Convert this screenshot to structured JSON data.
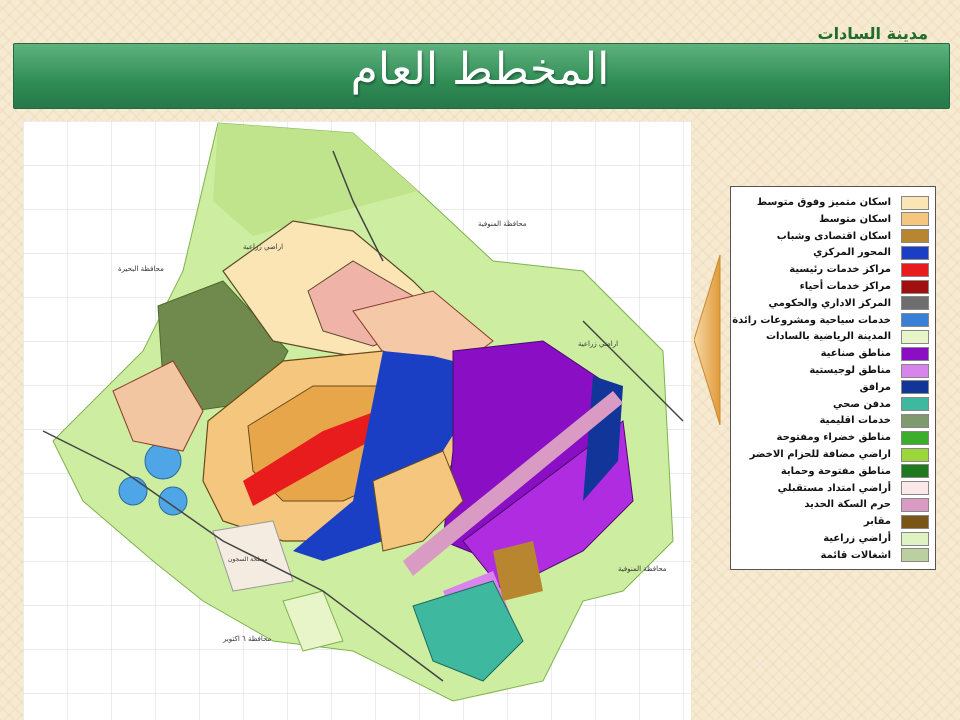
{
  "header": {
    "city_name": "مدينة السادات",
    "title": "المخطط العام"
  },
  "map": {
    "region_labels": {
      "beheira": "محافظة البحيرة",
      "menoufia_top": "محافظة المنوفية",
      "menoufia_right": "محافظة المنوفية",
      "october": "محافظة ٦ اكتوبر",
      "agri_top": "اراضي زراعية",
      "agri_right": "اراضي زراعية",
      "prisons": "مصلحة السجون"
    }
  },
  "legend": {
    "items": [
      {
        "label": "اسكان متميز وفوق متوسط",
        "color": "#fce5b4"
      },
      {
        "label": "اسكان متوسط",
        "color": "#f5c77e"
      },
      {
        "label": "اسكان اقتصادى وشباب",
        "color": "#b8862e"
      },
      {
        "label": "المحور المركزي",
        "color": "#1a3fc4"
      },
      {
        "label": "مراكز خدمات رئيسية",
        "color": "#e81c1c"
      },
      {
        "label": "مراكز خدمات أحياء",
        "color": "#a30f0f"
      },
      {
        "label": "المركز الاداري والحكومي",
        "color": "#6e6e6e"
      },
      {
        "label": "خدمات سياحية ومشروعات رائدة",
        "color": "#3a7fd6"
      },
      {
        "label": "المدينة الرياضية بالسادات",
        "color": "#e8f5c8"
      },
      {
        "label": "مناطق صناعية",
        "color": "#8a0ec4"
      },
      {
        "label": "مناطق لوجيستية",
        "color": "#d884ec"
      },
      {
        "label": "مرافق",
        "color": "#12359a"
      },
      {
        "label": "مدفن صحي",
        "color": "#3fb8a0"
      },
      {
        "label": "خدمات اقليمية",
        "color": "#7f9a6e"
      },
      {
        "label": "مناطق خضراء ومفتوحة",
        "color": "#3cae2c"
      },
      {
        "label": "اراضي مضافة للحزام الاخضر",
        "color": "#9bd63a"
      },
      {
        "label": "مناطق مفتوحة وحماية",
        "color": "#1f7a1f"
      },
      {
        "label": "أراضي امتداد مستقبلي",
        "color": "#fbe9e9"
      },
      {
        "label": "حرم السكة الحديد",
        "color": "#d99bc4"
      },
      {
        "label": "مقابر",
        "color": "#7a5616"
      },
      {
        "label": "أراضي زراعية",
        "color": "#dff3c2"
      },
      {
        "label": "اشغالات قائمة",
        "color": "#bccfa0"
      }
    ]
  }
}
